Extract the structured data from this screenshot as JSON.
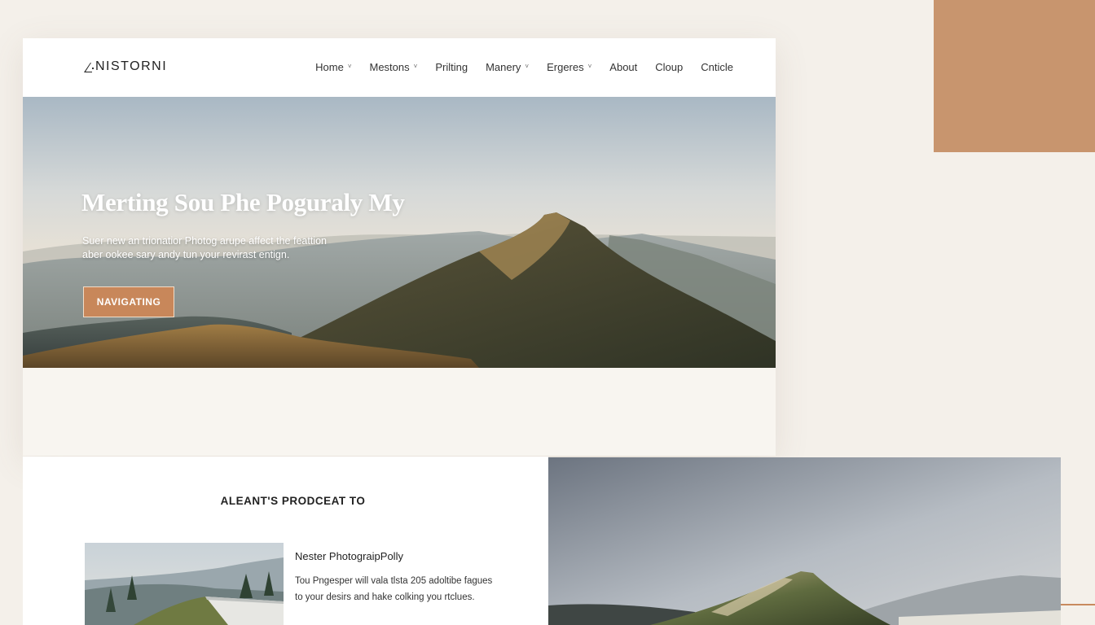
{
  "brand": {
    "logo_text": "NISTORNI",
    "logo_glyph": "stylized-a-icon"
  },
  "nav": {
    "items": [
      {
        "label": "Home",
        "has_dropdown": true
      },
      {
        "label": "Mestons",
        "has_dropdown": true
      },
      {
        "label": "Prilting",
        "has_dropdown": false
      },
      {
        "label": "Manery",
        "has_dropdown": true
      },
      {
        "label": "Ergeres",
        "has_dropdown": true
      },
      {
        "label": "About",
        "has_dropdown": false
      },
      {
        "label": "Cloup",
        "has_dropdown": false
      },
      {
        "label": "Cnticle",
        "has_dropdown": false
      }
    ],
    "dropdown_glyph": "˅"
  },
  "hero": {
    "title": "Merting Sou Phe Poguraly My",
    "subtitle_line1": "Suer new an trionatior Photog arupe affect the feattion",
    "subtitle_line2": "aber ookee sary andy tun your revirast entign.",
    "cta_label": "NAVIGATING",
    "image_subject": "mountain-peak-at-sunrise"
  },
  "featured": {
    "heading": "ALEANT'S PRODCEAT TO",
    "item": {
      "title": "Nester PhotograipPolly",
      "body_line1": "Tou Pngesper will vala tlsta 205 adoltibe fagues",
      "body_line2": "to your desirs and hake colking you rtclues.",
      "thumbnail_subject": "misty-valley-with-walkway"
    }
  },
  "side_photo": {
    "subject": "green-ridge-peak-under-grey-sky"
  },
  "colors": {
    "page_bg": "#f4f0ea",
    "accent": "#c8956e",
    "cta": "#c8875a",
    "text_dark": "#222222"
  }
}
